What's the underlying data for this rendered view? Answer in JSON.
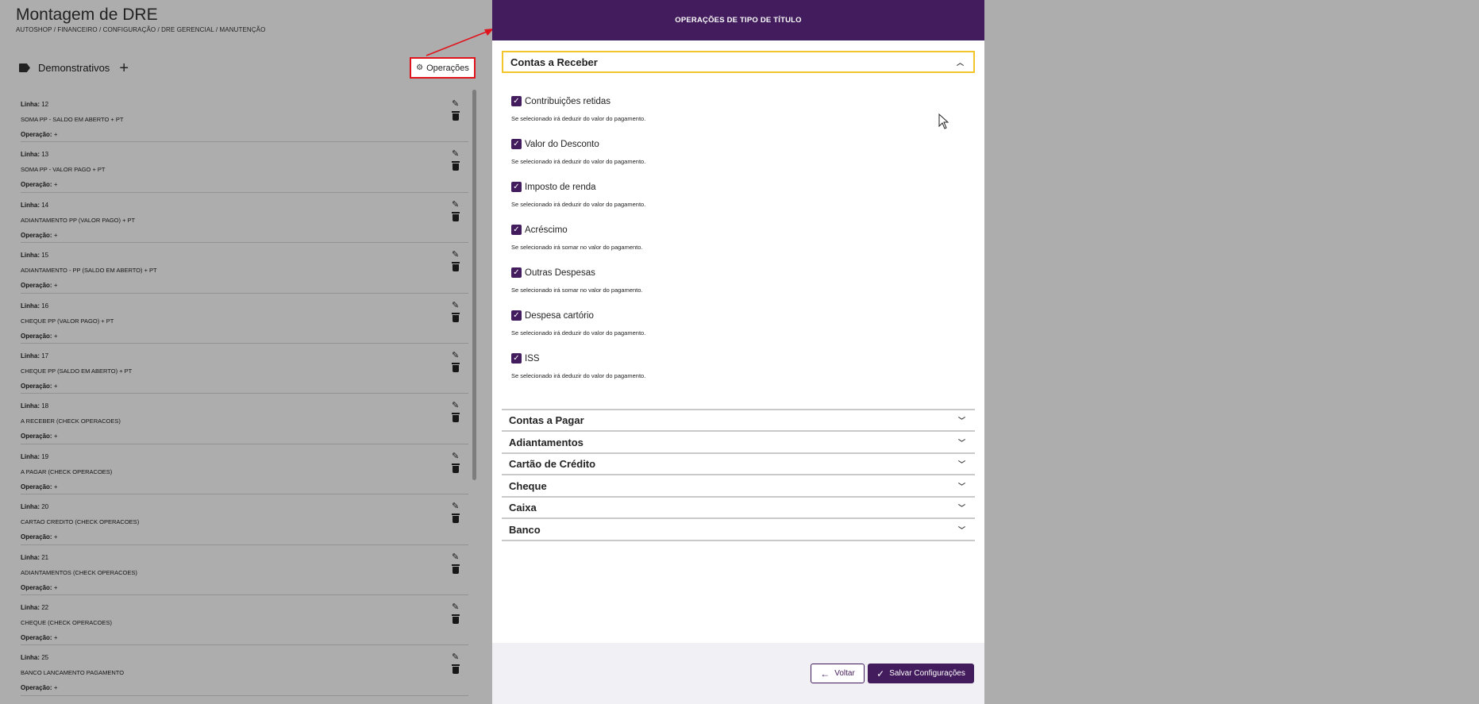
{
  "page": {
    "title": "Montagem de DRE",
    "breadcrumb": "AUTOSHOP / FINANCEIRO / CONFIGURAÇÃO / DRE GERENCIAL / MANUTENÇÃO",
    "demonstrativos_label": "Demonstrativos",
    "operacoes_button": "Operações",
    "line_prefix": "Linha:",
    "operation_prefix": "Operação:",
    "rows": [
      {
        "line": "12",
        "desc": "SOMA PP - SALDO EM ABERTO + PT",
        "op": "+"
      },
      {
        "line": "13",
        "desc": "SOMA PP - VALOR PAGO + PT",
        "op": "+"
      },
      {
        "line": "14",
        "desc": "ADIANTAMENTO PP (VALOR PAGO) + PT",
        "op": "+"
      },
      {
        "line": "15",
        "desc": "ADIANTAMENTO - PP (SALDO EM ABERTO) + PT",
        "op": "+"
      },
      {
        "line": "16",
        "desc": "CHEQUE PP (VALOR PAGO) + PT",
        "op": "+"
      },
      {
        "line": "17",
        "desc": "CHEQUE PP (SALDO EM ABERTO) + PT",
        "op": "+"
      },
      {
        "line": "18",
        "desc": "A RECEBER (CHECK OPERACOES)",
        "op": "+"
      },
      {
        "line": "19",
        "desc": "A PAGAR (CHECK OPERACOES)",
        "op": "+"
      },
      {
        "line": "20",
        "desc": "CARTAO CREDITO (CHECK OPERACOES)",
        "op": "+"
      },
      {
        "line": "21",
        "desc": "ADIANTAMENTOS (CHECK OPERACOES)",
        "op": "+"
      },
      {
        "line": "22",
        "desc": "CHEQUE (CHECK OPERACOES)",
        "op": "+"
      },
      {
        "line": "25",
        "desc": "BANCO LANCAMENTO PAGAMENTO",
        "op": "+"
      }
    ]
  },
  "modal": {
    "title": "OPERAÇÕES DE TIPO DE TÍTULO",
    "open_section": "Contas a Receber",
    "checks": [
      {
        "label": "Contribuições retidas",
        "hint": "Se selecionado irá deduzir do valor do pagamento.",
        "checked": true
      },
      {
        "label": "Valor do Desconto",
        "hint": "Se selecionado irá deduzir do valor do pagamento.",
        "checked": true
      },
      {
        "label": "Imposto de renda",
        "hint": "Se selecionado irá deduzir do valor do pagamento.",
        "checked": true
      },
      {
        "label": "Acréscimo",
        "hint": "Se selecionado irá somar no valor do pagamento.",
        "checked": true
      },
      {
        "label": "Outras Despesas",
        "hint": "Se selecionado irá somar no valor do pagamento.",
        "checked": true
      },
      {
        "label": "Despesa cartório",
        "hint": "Se selecionado irá deduzir do valor do pagamento.",
        "checked": true
      },
      {
        "label": "ISS",
        "hint": "Se selecionado irá deduzir do valor do pagamento.",
        "checked": true
      }
    ],
    "sections": [
      "Contas a Pagar",
      "Adiantamentos",
      "Cartão de Crédito",
      "Cheque",
      "Caixa",
      "Banco"
    ],
    "back_button": "Voltar",
    "save_button": "Salvar Configurações"
  },
  "colors": {
    "primary": "#421c5c",
    "highlight": "#e0141c",
    "focus": "#f2c52c"
  },
  "icons": [
    "tag-icon",
    "plus-icon",
    "gear-icon",
    "pencil-icon",
    "trash-icon",
    "chevron-up-icon",
    "chevron-down-icon",
    "checkbox-icon",
    "arrow-left-icon",
    "check-icon",
    "mouse-cursor-icon"
  ]
}
